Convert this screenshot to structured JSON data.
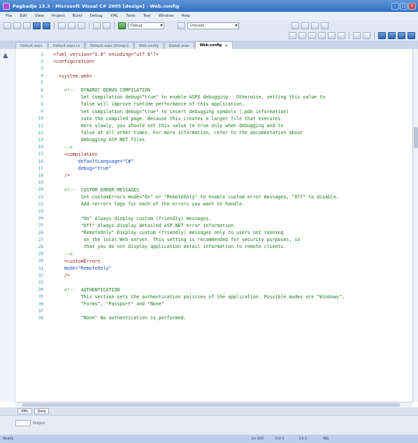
{
  "window": {
    "title": "Pagbadje 13.3 - Microsoft Visual C# 2005 [design] - Web.config"
  },
  "menu": [
    "File",
    "Edit",
    "View",
    "Project",
    "Build",
    "Debug",
    "XML",
    "Tools",
    "Test",
    "Window",
    "Help"
  ],
  "toolbar": {
    "config_select": "Debug",
    "platform_select": "Unicode"
  },
  "tabs": [
    {
      "label": "Default.aspx"
    },
    {
      "label": "Default.aspx.cs"
    },
    {
      "label": "Default.aspx [Design]"
    },
    {
      "label": "Web.config"
    },
    {
      "label": "Global.asax"
    },
    {
      "label": "Web.config",
      "active": true
    }
  ],
  "code_lines": [
    {
      "n": "1",
      "text": "<?xml version=\"1.0\" encoding=\"utf-8\"?>",
      "kind": "tag"
    },
    {
      "n": "2",
      "text": "<configuration>",
      "kind": "tag"
    },
    {
      "n": "3",
      "text": "",
      "kind": "code"
    },
    {
      "n": "4",
      "text": "  <system.web>",
      "kind": "tag"
    },
    {
      "n": "5",
      "text": "",
      "kind": "code"
    },
    {
      "n": "6",
      "text": "    <!--  DYNAMIC DEBUG COMPILATION",
      "kind": "comment"
    },
    {
      "n": "7",
      "text": "          Set compilation debug=\"true\" to enable ASPX debugging.  Otherwise, setting this value to",
      "kind": "comment"
    },
    {
      "n": "8",
      "text": "          false will improve runtime performance of this application.",
      "kind": "comment"
    },
    {
      "n": "9",
      "text": "          Set compilation debug=\"true\" to insert debugging symbols (.pdb information)",
      "kind": "comment"
    },
    {
      "n": "10",
      "text": "          into the compiled page. Because this creates a larger file that executes",
      "kind": "comment"
    },
    {
      "n": "11",
      "text": "          more slowly, you should set this value to true only when debugging and to",
      "kind": "comment"
    },
    {
      "n": "12",
      "text": "          false at all other times. For more information, refer to the documentation about",
      "kind": "comment"
    },
    {
      "n": "13",
      "text": "          debugging ASP.NET files.",
      "kind": "comment"
    },
    {
      "n": "14",
      "text": "    -->",
      "kind": "comment"
    },
    {
      "n": "15",
      "text": "    <compilation",
      "kind": "tag"
    },
    {
      "n": "16",
      "text": "         defaultLanguage=\"C#\"",
      "kind": "attr"
    },
    {
      "n": "17",
      "text": "         debug=\"true\"",
      "kind": "attr"
    },
    {
      "n": "18",
      "text": "    />",
      "kind": "tag"
    },
    {
      "n": "19",
      "text": "",
      "kind": "code"
    },
    {
      "n": "20",
      "text": "    <!--  CUSTOM ERROR MESSAGES",
      "kind": "comment"
    },
    {
      "n": "21",
      "text": "          Set customErrors mode=\"On\" or \"RemoteOnly\" to enable custom error messages, \"Off\" to disable.",
      "kind": "comment"
    },
    {
      "n": "22",
      "text": "          Add <error> tags for each of the errors you want to handle.",
      "kind": "comment"
    },
    {
      "n": "23",
      "text": "",
      "kind": "comment"
    },
    {
      "n": "24",
      "text": "          \"On\" Always display custom (friendly) messages.",
      "kind": "comment"
    },
    {
      "n": "25",
      "text": "          \"Off\" Always display detailed ASP.NET error information.",
      "kind": "comment"
    },
    {
      "n": "26",
      "text": "          \"RemoteOnly\" Display custom (friendly) messages only to users not running",
      "kind": "comment"
    },
    {
      "n": "27",
      "text": "           on the local Web server. This setting is recommended for security purposes, so",
      "kind": "comment"
    },
    {
      "n": "28",
      "text": "           that you do not display application detail information to remote clients.",
      "kind": "comment"
    },
    {
      "n": "29",
      "text": "    -->",
      "kind": "comment"
    },
    {
      "n": "30",
      "text": "    <customErrors",
      "kind": "tag"
    },
    {
      "n": "31",
      "text": "    mode=\"RemoteOnly\"",
      "kind": "attr"
    },
    {
      "n": "32",
      "text": "    />",
      "kind": "tag"
    },
    {
      "n": "33",
      "text": "",
      "kind": "code"
    },
    {
      "n": "34",
      "text": "    <!--  AUTHENTICATION",
      "kind": "comment"
    },
    {
      "n": "35",
      "text": "          This section sets the authentication policies of the application. Possible modes are \"Windows\",",
      "kind": "comment"
    },
    {
      "n": "36",
      "text": "          \"Forms\", \"Passport\" and \"None\"",
      "kind": "comment"
    },
    {
      "n": "37",
      "text": "",
      "kind": "comment"
    },
    {
      "n": "38",
      "text": "          \"None\" No authentication is performed.",
      "kind": "comment"
    }
  ],
  "view_tabs": [
    "XML",
    "Data"
  ],
  "find_tab": "Output",
  "status": {
    "ready": "Ready",
    "ln": "Ln 102",
    "col": "Col 1",
    "ch": "Ch 1",
    "mode": "INS"
  }
}
